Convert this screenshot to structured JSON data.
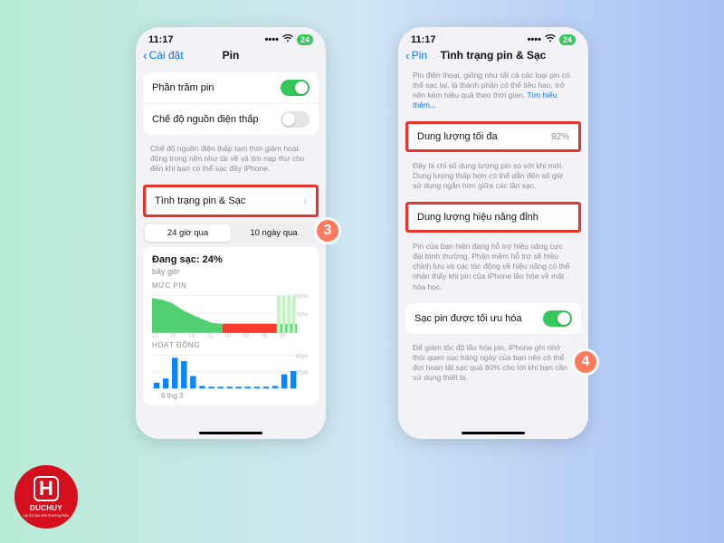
{
  "status": {
    "time": "11:17",
    "batt": "24"
  },
  "badges": {
    "left": "3",
    "right": "4"
  },
  "logo": {
    "letter": "H",
    "name": "DUCHUY",
    "tagline": "Uy tín tạo nên thương hiệu"
  },
  "left": {
    "back": "Cài đặt",
    "title": "Pin",
    "rows": {
      "percent": "Phần trăm pin",
      "lowpower": "Chế độ nguồn điện thấp",
      "health": "Tình trạng pin & Sạc"
    },
    "lowpower_note": "Chế độ nguồn điện thấp tạm thời giảm hoạt động trong nền như tải về và tìm nạp thư cho đến khi bạn có thể sạc đầy iPhone.",
    "seg": {
      "a": "24 giờ qua",
      "b": "10 ngày qua"
    },
    "charging": {
      "title": "Đang sạc: 24%",
      "sub": "bây giờ"
    },
    "level_label": "MỨC PIN",
    "activity_label": "HOẠT ĐỘNG",
    "date": "6 thg 3"
  },
  "right": {
    "back": "Pin",
    "title": "Tình trạng pin & Sạc",
    "intro": "Pin điện thoại, giống như tất cả các loại pin có thể sạc lại, là thành phần có thể tiêu hao, trở nên kém hiệu quả theo thời gian.",
    "learn_more": "Tìm hiểu thêm...",
    "max_cap": {
      "label": "Dung lượng tối đa",
      "value": "92%"
    },
    "max_note": "Đây là chỉ số dung lượng pin so với khi mới. Dung lượng thấp hơn có thể dẫn đến số giờ sử dụng ngắn hơn giữa các lần sạc.",
    "peak": "Dung lượng hiệu năng đỉnh",
    "peak_note": "Pin của bạn hiện đang hỗ trợ hiệu năng cực đại bình thường. Phần mềm hỗ trợ sẽ hiệu chỉnh lưu và các tác động về hiệu năng có thể nhận thấy khi pin của iPhone lão hóa về mặt hóa học.",
    "opt": "Sạc pin được tối ưu hóa",
    "opt_note": "Để giảm tốc độ lão hóa pin, iPhone ghi nhớ thói quen sạc hàng ngày của bạn nên có thể đợi hoàn tất sạc quá 80% cho tới khi bạn cần sử dụng thiết bị."
  },
  "chart_data": [
    {
      "type": "area",
      "title": "MỨC PIN",
      "ylabel": "%",
      "ylim": [
        0,
        100
      ],
      "x": [
        "12",
        "15",
        "18",
        "21",
        "00",
        "03",
        "06",
        "09"
      ],
      "series": [
        {
          "name": "level",
          "values": [
            95,
            90,
            80,
            65,
            50,
            40,
            30,
            28,
            26,
            25,
            24,
            24,
            24,
            24,
            24,
            24
          ],
          "color": "#34c759",
          "fill": true
        },
        {
          "name": "charging",
          "values": [
            0,
            0,
            0,
            0,
            0,
            0,
            0,
            0,
            0,
            0,
            0,
            0,
            0,
            0,
            24,
            24
          ],
          "color": "#bdf7be"
        },
        {
          "name": "low",
          "values": [
            0,
            0,
            0,
            0,
            0,
            0,
            0,
            0,
            26,
            25,
            24,
            24,
            24,
            24,
            0,
            0
          ],
          "color": "#ff3b30"
        }
      ]
    },
    {
      "type": "bar",
      "title": "HOẠT ĐỘNG",
      "ylabel": "ph",
      "ylim": [
        0,
        60
      ],
      "x": [
        "12",
        "15",
        "18",
        "21",
        "00",
        "03",
        "06",
        "09"
      ],
      "values": [
        10,
        18,
        55,
        48,
        22,
        4,
        3,
        2,
        3,
        2,
        2,
        2,
        2,
        3,
        25,
        30
      ],
      "color": "#0a84ff"
    }
  ]
}
